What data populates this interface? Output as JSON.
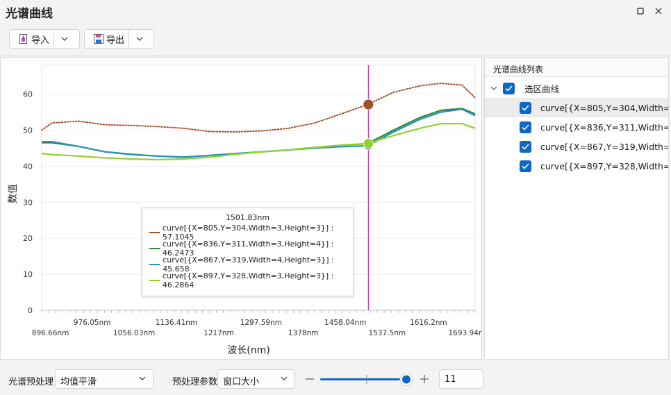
{
  "window": {
    "title": "光谱曲线"
  },
  "toolbar": {
    "import_label": "导入",
    "export_label": "导出"
  },
  "chart_data": {
    "type": "line",
    "ylabel": "数值",
    "xlabel": "波长(nm)",
    "ylim": [
      0,
      68
    ],
    "yticks": [
      0,
      10,
      20,
      30,
      40,
      50,
      60
    ],
    "xticks_row1": [
      "976.05nm",
      "1136.41nm",
      "1297.59nm",
      "1458.04nm",
      "1616.2nm"
    ],
    "xticks_row2": [
      "896.66nm",
      "1056.03nm",
      "1217nm",
      "1378nm",
      "1537.5nm",
      "1693.94nm"
    ],
    "xlim": [
      880,
      1705
    ],
    "cursor_x": 1501.83,
    "x": [
      880,
      900,
      950,
      1000,
      1050,
      1100,
      1150,
      1200,
      1250,
      1300,
      1350,
      1400,
      1450,
      1500,
      1550,
      1600,
      1640,
      1680,
      1705
    ],
    "series": [
      {
        "name": "curve[{X=805,Y=304,Width=3,Height=3}]",
        "color": "#a0522d",
        "dotted": true,
        "values": [
          50,
          52,
          52.5,
          51.5,
          51.3,
          51,
          50.5,
          49.6,
          49.5,
          49.8,
          50.5,
          52,
          54.5,
          57.1,
          60.5,
          62.3,
          63,
          62.5,
          59
        ]
      },
      {
        "name": "curve[{X=836,Y=311,Width=3,Height=4}]",
        "color": "#2e8b2e",
        "dotted": false,
        "values": [
          46.5,
          46.5,
          45.5,
          44,
          43.3,
          42.8,
          42.5,
          43,
          43.5,
          44,
          44.5,
          45.2,
          45.8,
          46.25,
          50,
          53.5,
          55.5,
          56,
          54.5
        ]
      },
      {
        "name": "curve[{X=867,Y=319,Width=4,Height=3}]",
        "color": "#2a8ec9",
        "dotted": false,
        "values": [
          46.8,
          46.8,
          45.5,
          44,
          43.2,
          42.8,
          42.5,
          43,
          43.5,
          44,
          44.5,
          45,
          45.4,
          45.66,
          49.5,
          53,
          55,
          55.8,
          54
        ]
      },
      {
        "name": "curve[{X=897,Y=328,Width=3,Height=3}]",
        "color": "#8ed32e",
        "dotted": false,
        "values": [
          43.5,
          43.2,
          42.8,
          42.3,
          42,
          41.8,
          42,
          42.5,
          43.3,
          44,
          44.5,
          45.2,
          45.8,
          46.29,
          48.5,
          50.5,
          51.8,
          51.8,
          50.5
        ]
      }
    ],
    "tooltip": {
      "header": "1501.83nm",
      "rows": [
        "curve[{X=805,Y=304,Width=3,Height=3}] : 57.1045",
        "curve[{X=836,Y=311,Width=3,Height=4}] : 46.2473",
        "curve[{X=867,Y=319,Width=4,Height=3}] : 45.658",
        "curve[{X=897,Y=328,Width=3,Height=3}] : 46.2864"
      ]
    }
  },
  "sidebar": {
    "header": "光谱曲线列表",
    "group_label": "选区曲线",
    "items": [
      "curve[{X=805,Y=304,Width=...",
      "curve[{X=836,Y=311,Width=...",
      "curve[{X=867,Y=319,Width=...",
      "curve[{X=897,Y=328,Width=..."
    ]
  },
  "bottom": {
    "preprocess_label": "光谱预处理",
    "preprocess_value": "均值平滑",
    "param_label": "预处理参数",
    "param_value": "窗口大小",
    "slider_value": 11,
    "slider_max": 11,
    "number_value": "11"
  },
  "colors": {
    "accent": "#0f67c4",
    "cursor_line": "#c52fc5"
  }
}
